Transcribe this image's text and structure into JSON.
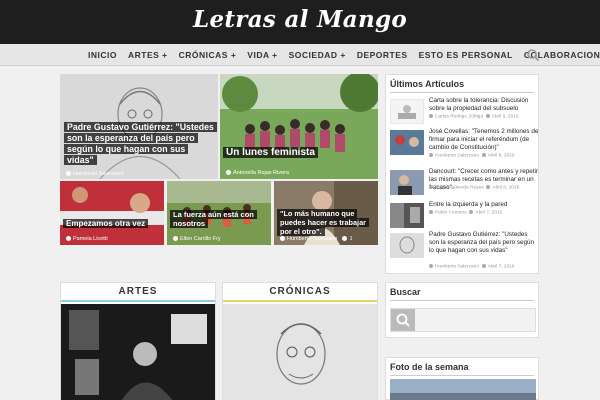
{
  "site": {
    "logo": "Letras al Mango"
  },
  "nav": {
    "items": [
      "INICIO",
      "ARTES +",
      "CRÓNICAS +",
      "VIDA +",
      "SOCIEDAD +",
      "DEPORTES",
      "ESTO ES PERSONAL",
      "COLABORACIONES"
    ]
  },
  "featured": {
    "main1": {
      "title": "Padre Gustavo Gutiérrez: \"Ustedes son la esperanza del país pero según lo que hagan con sus vidas\"",
      "author": "Humberto Salerzano"
    },
    "main2": {
      "title": "Un lunes feminista",
      "author": "Antonella Rojas Rivera"
    },
    "small1": {
      "title": "Empezamos otra vez",
      "author": "Pamela Licetti"
    },
    "small2": {
      "title": "La fuerza aún está con nosotros",
      "author": "Ellen Carrillo Fry"
    },
    "small3": {
      "title": "\"Lo más humano que puedes hacer es trabajar por el otro\".",
      "author": "Humberto Salerzano",
      "comments": "1"
    }
  },
  "sidebar": {
    "latest_title": "Últimos Artículos",
    "latest": [
      {
        "title": "Carta sobre la tolerancia: Discusión sobre la propiedad del subsuelo",
        "author": "Carlos Rodrigo Zúñiga",
        "date": "Abril 9, 2016"
      },
      {
        "title": "José Covellas: \"Tenemos 2 millones de firmar para iniciar el referéndum (de cambio de Constitución)\"",
        "author": "Humberto Salerzano",
        "date": "Abril 8, 2016"
      },
      {
        "title": "Dancourt: \"Crecer como antes y repetir las mismas recetas es terminar en un fracaso\".",
        "author": "Carlos Valverde Reyes",
        "date": "Abril 8, 2016"
      },
      {
        "title": "Entre la izquierda y la pared",
        "author": "Pablo Centeno",
        "date": "Abril 7, 2016"
      },
      {
        "title": "Padre Gustavo Gutiérrez: \"Ustedes son la esperanza del país pero según lo que hagan con sus vidas\"",
        "author": "Humberto Salerzano",
        "date": "Abril 7, 2016"
      }
    ],
    "search_title": "Buscar",
    "photo_title": "Foto de la semana"
  },
  "categories": {
    "artes": "ARTES",
    "cronicas": "CRÓNICAS"
  },
  "colors": {
    "header_bg": "#1e1e1e",
    "nav_bg": "#e6e6e6",
    "artes_accent": "#8fc8e8",
    "cronicas_accent": "#e8d36a"
  }
}
